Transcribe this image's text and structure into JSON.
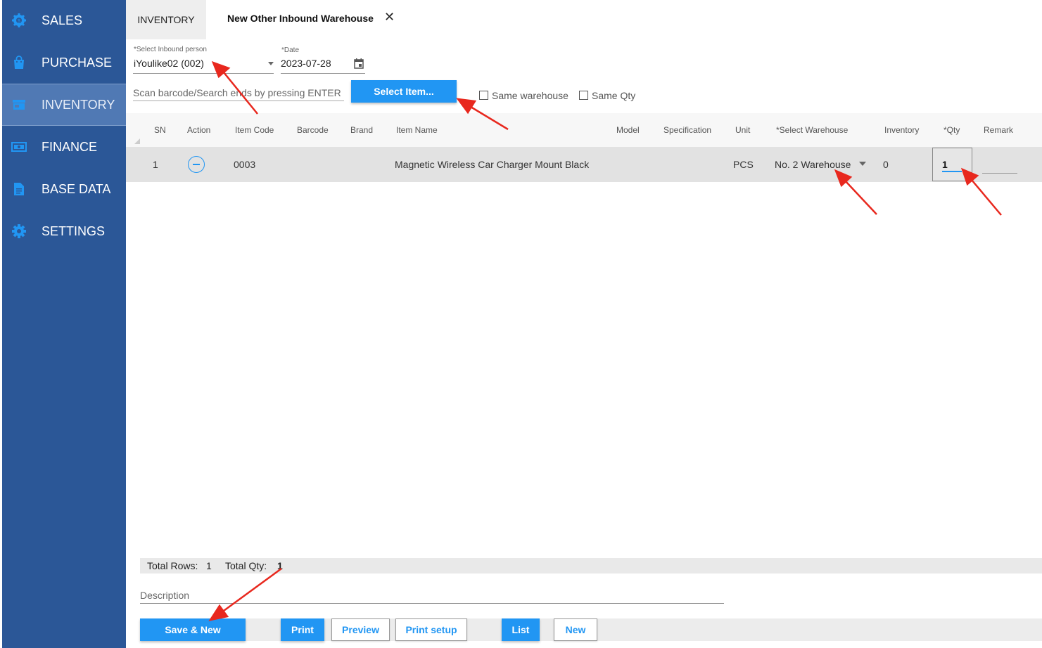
{
  "sidebar": {
    "items": [
      {
        "label": "SALES",
        "icon": "gear-badge-icon"
      },
      {
        "label": "PURCHASE",
        "icon": "shopping-bag-icon"
      },
      {
        "label": "INVENTORY",
        "icon": "store-icon",
        "active": true
      },
      {
        "label": "FINANCE",
        "icon": "cash-icon"
      },
      {
        "label": "BASE DATA",
        "icon": "document-icon"
      },
      {
        "label": "SETTINGS",
        "icon": "gear-icon"
      }
    ]
  },
  "tabs": {
    "inventory": "INVENTORY",
    "active": "New Other Inbound Warehouse",
    "close": "✕"
  },
  "form": {
    "inbound_person": {
      "label": "*Select Inbound person",
      "value": "iYoulike02 (002)"
    },
    "date": {
      "label": "*Date",
      "value": "2023-07-28"
    },
    "scan_placeholder": "Scan barcode/Search ends by pressing ENTER",
    "select_item_button": "Select Item...",
    "same_warehouse_label": "Same warehouse",
    "same_qty_label": "Same Qty"
  },
  "table": {
    "columns": [
      "SN",
      "Action",
      "Item Code",
      "Barcode",
      "Brand",
      "Item Name",
      "Model",
      "Specification",
      "Unit",
      "*Select Warehouse",
      "Inventory",
      "*Qty",
      "Remark"
    ],
    "rows": [
      {
        "sn": "1",
        "item_code": "0003",
        "barcode": "",
        "brand": "",
        "item_name": "Magnetic Wireless Car Charger Mount Black",
        "model": "",
        "specification": "",
        "unit": "PCS",
        "warehouse": "No. 2 Warehouse",
        "inventory": "0",
        "qty": "1",
        "remark": ""
      }
    ]
  },
  "totals": {
    "rows_label": "Total Rows:",
    "rows_value": "1",
    "qty_label": "Total Qty:",
    "qty_value": "1"
  },
  "description_placeholder": "Description",
  "buttons": {
    "save_new": "Save & New",
    "print": "Print",
    "preview": "Preview",
    "print_setup": "Print setup",
    "list": "List",
    "new": "New"
  },
  "colors": {
    "sidebar": "#2b5797",
    "sidebar_active": "#5079b4",
    "accent": "#2196f3",
    "annotation_arrow": "#e8281e"
  }
}
